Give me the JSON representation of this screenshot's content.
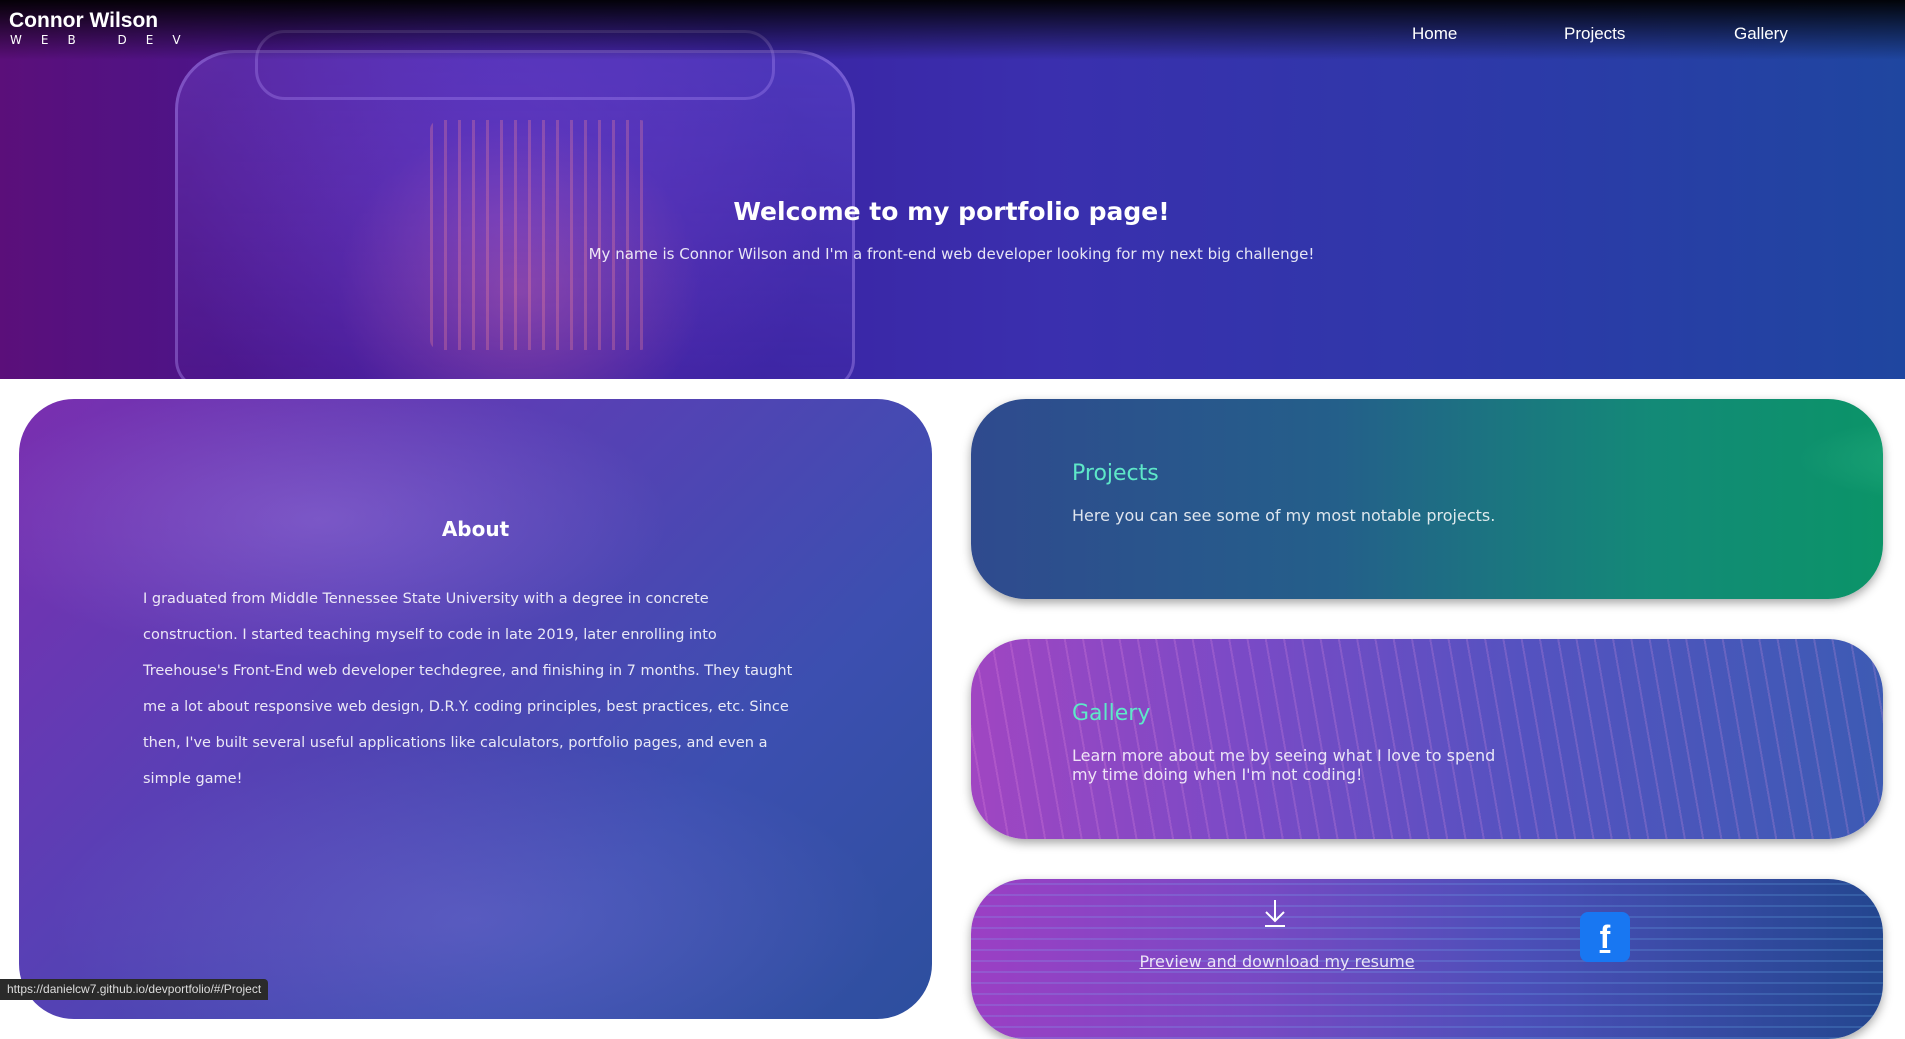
{
  "brand": {
    "name": "Connor Wilson",
    "tagline": "WEB DEV"
  },
  "nav": {
    "home": "Home",
    "projects": "Projects",
    "gallery": "Gallery"
  },
  "hero": {
    "title": "Welcome to my portfolio page!",
    "subtitle": "My name is Connor Wilson and I'm a front-end web developer looking for my next big challenge!"
  },
  "about": {
    "title": "About",
    "text": "I graduated from Middle Tennessee State University with a degree in concrete construction. I started teaching myself to code in late 2019, later enrolling into Treehouse's Front-End web developer techdegree, and finishing in 7 months. They taught me a lot about responsive web design, D.R.Y. coding principles, best practices, etc. Since then, I've built several useful applications like calculators, portfolio pages, and even a simple game!"
  },
  "cards": {
    "projects": {
      "title": "Projects",
      "description": "Here you can see some of my most notable projects."
    },
    "gallery": {
      "title": "Gallery",
      "description": "Learn more about me by seeing what I love to spend my time doing when I'm not coding!"
    },
    "resume": {
      "label": "Preview and download my resume",
      "icon": "download-icon",
      "social_icon": "facebook-icon",
      "social_color": "#1877f2"
    }
  },
  "status": {
    "url": "https://danielcw7.github.io/devportfolio/#/Project"
  }
}
